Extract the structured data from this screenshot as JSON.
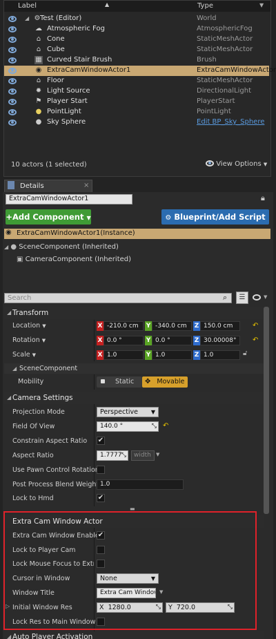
{
  "outliner": {
    "col_label": "Label",
    "col_type": "Type",
    "items": [
      {
        "name": "Test (Editor)",
        "type": "World"
      },
      {
        "name": "Atmospheric Fog",
        "type": "AtmosphericFog"
      },
      {
        "name": "Cone",
        "type": "StaticMeshActor"
      },
      {
        "name": "Cube",
        "type": "StaticMeshActor"
      },
      {
        "name": "Curved Stair Brush",
        "type": "Brush"
      },
      {
        "name": "ExtraCamWindowActor1",
        "type": "ExtraCamWindowActor"
      },
      {
        "name": "Floor",
        "type": "StaticMeshActor"
      },
      {
        "name": "Light Source",
        "type": "DirectionalLight"
      },
      {
        "name": "Player Start",
        "type": "PlayerStart"
      },
      {
        "name": "PointLight",
        "type": "PointLight"
      },
      {
        "name": "Sky Sphere",
        "type": "Edit BP_Sky_Sphere"
      }
    ],
    "status": "10 actors (1 selected)",
    "view_options": "View Options"
  },
  "details": {
    "tab": "Details",
    "actor_name": "ExtraCamWindowActor1",
    "add_component": "+Add Component",
    "blueprint": "Blueprint/Add Script",
    "instance": "ExtraCamWindowActor1(Instance)",
    "scene_comp": "SceneComponent (Inherited)",
    "camera_comp": "CameraComponent (Inherited)",
    "search_placeholder": "Search"
  },
  "transform": {
    "title": "Transform",
    "location_label": "Location",
    "location": [
      "-210.0 cm",
      "-340.0 cm",
      "150.0 cm"
    ],
    "rotation_label": "Rotation",
    "rotation": [
      "0.0 °",
      "0.0 °",
      "30.00008°"
    ],
    "scale_label": "Scale",
    "scale": [
      "1.0",
      "1.0",
      "1.0"
    ],
    "x": "X",
    "y": "Y",
    "z": "Z"
  },
  "scene_component": {
    "title": "SceneComponent",
    "mobility_label": "Mobility",
    "static": "Static",
    "movable": "Movable"
  },
  "camera": {
    "title": "Camera Settings",
    "projection_label": "Projection Mode",
    "projection": "Perspective",
    "fov_label": "Field Of View",
    "fov": "140.0 °",
    "constrain_label": "Constrain Aspect Ratio",
    "aspect_label": "Aspect Ratio",
    "aspect": "1.7777",
    "aspect_unit": "width",
    "pawn_label": "Use Pawn Control Rotation",
    "blend_label": "Post Process Blend Weight",
    "blend": "1.0",
    "hmd_label": "Lock to Hmd"
  },
  "extra": {
    "title": "Extra Cam Window Actor",
    "enabled_label": "Extra Cam Window Enabled",
    "lockplayer_label": "Lock to Player Cam",
    "lockmouse_label": "Lock Mouse Focus to Extra",
    "cursor_label": "Cursor in Window",
    "cursor": "None",
    "wtitle_label": "Window Title",
    "wtitle": "Extra Cam Window",
    "res_label": "Initial Window Res",
    "res_x": "1280.0",
    "res_y": "720.0",
    "lockres_label": "Lock Res to Main Window"
  },
  "auto_player": {
    "title": "Auto Player Activation"
  },
  "colors": {
    "selection": "#c9a873",
    "add_green": "#3f9b35",
    "blueprint_blue": "#2b6cb0",
    "highlight_red": "#e0222a"
  }
}
